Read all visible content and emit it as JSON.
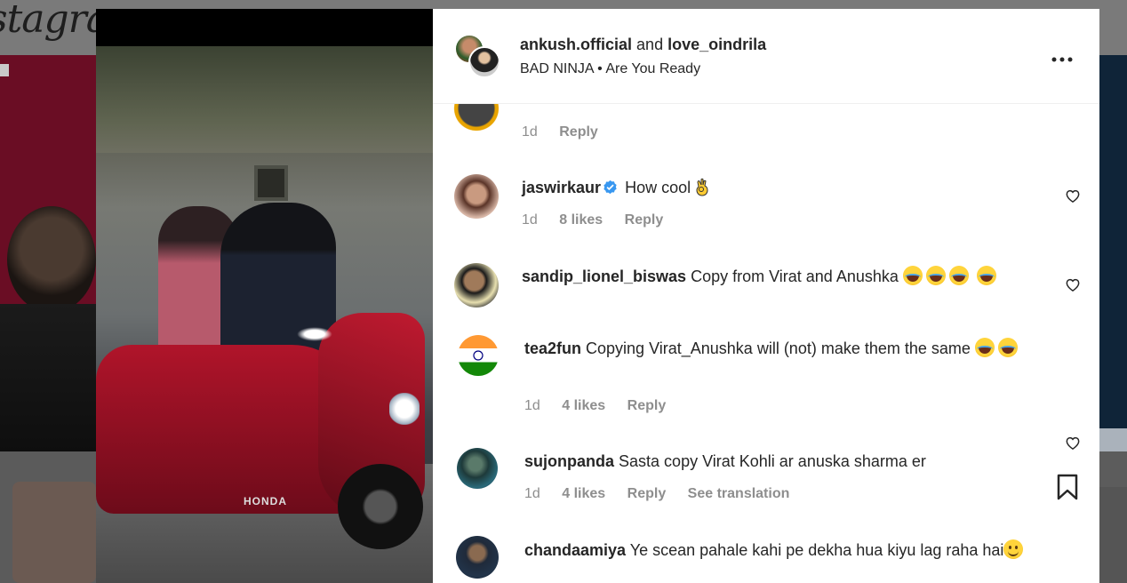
{
  "background": {
    "logo_text": "stagram"
  },
  "media": {
    "overlay_text": "HONDA"
  },
  "post": {
    "users": [
      "ankush.official",
      "love_oindrila"
    ],
    "users_joiner": "and",
    "audio_artist": "BAD NINJA",
    "audio_separator": "•",
    "audio_title": "Are You Ready"
  },
  "comments": [
    {
      "username": "",
      "text": "",
      "time": "1d",
      "likes": "",
      "reply": "Reply"
    },
    {
      "username": "jaswirkaur",
      "verified": true,
      "text": "How cool",
      "trailing_emoji": "ok-hand",
      "time": "1d",
      "likes": "8 likes",
      "reply": "Reply"
    },
    {
      "username": "sandip_lionel_biswas",
      "text": "Copy from Virat and Anushka",
      "trailing_emoji": "laughing-crying x4",
      "time": "",
      "likes": "",
      "reply": ""
    },
    {
      "username": "tea2fun",
      "text": "Copying Virat_Anushka will (not) make them the same",
      "trailing_emoji": "laughing-crying x2",
      "time": "1d",
      "likes": "4 likes",
      "reply": "Reply"
    },
    {
      "username": "sujonpanda",
      "text": "Sasta copy Virat Kohli ar anuska sharma er",
      "time": "1d",
      "likes": "4 likes",
      "reply": "Reply",
      "translate": "See translation"
    },
    {
      "username": "chandaamiya",
      "text": "Ye scean pahale kahi pe dekha hua kiyu lag raha hai",
      "trailing_emoji": "smiling-face",
      "time": "",
      "likes": "",
      "reply": ""
    }
  ],
  "icons": {
    "more": "more-horizontal-icon",
    "heart": "heart-outline-icon",
    "verified": "verified-badge-icon",
    "bookmark": "bookmark-outline-icon"
  },
  "colors": {
    "text_primary": "#262626",
    "text_secondary": "#8e8e8e",
    "verified_blue": "#3897f0",
    "panel_bg": "#ffffff"
  }
}
